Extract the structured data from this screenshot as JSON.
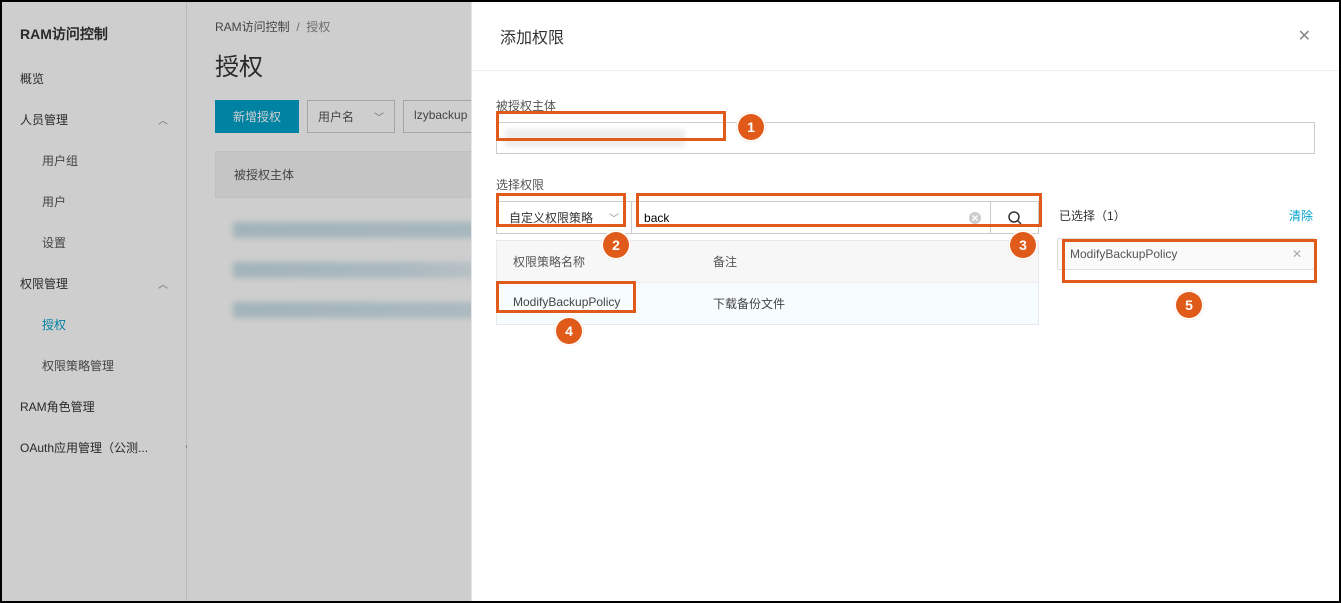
{
  "sidebar": {
    "title": "RAM访问控制",
    "items": [
      {
        "label": "概览"
      },
      {
        "label": "人员管理",
        "expandable": true
      },
      {
        "label": "用户组",
        "sub": true
      },
      {
        "label": "用户",
        "sub": true
      },
      {
        "label": "设置",
        "sub": true
      },
      {
        "label": "权限管理",
        "expandable": true
      },
      {
        "label": "授权",
        "sub": true,
        "active": true
      },
      {
        "label": "权限策略管理",
        "sub": true
      },
      {
        "label": "RAM角色管理"
      },
      {
        "label": "OAuth应用管理（公测..."
      }
    ]
  },
  "breadcrumbs": {
    "root": "RAM访问控制",
    "current": "授权"
  },
  "page_title": "授权",
  "toolbar": {
    "new_btn": "新增授权",
    "filter_type": "用户名",
    "filter_value": "lzybackup"
  },
  "table": {
    "col1": "被授权主体"
  },
  "panel": {
    "title": "添加权限",
    "subject_label": "被授权主体",
    "perm_label": "选择权限",
    "policy_type": "自定义权限策略",
    "search_value": "back",
    "table": {
      "col_name": "权限策略名称",
      "col_note": "备注",
      "rows": [
        {
          "name": "ModifyBackupPolicy",
          "note": "下载备份文件"
        }
      ]
    },
    "selected_label_prefix": "已选择（",
    "selected_count": "1",
    "selected_label_suffix": "）",
    "clear_label": "清除",
    "selected_items": [
      {
        "name": "ModifyBackupPolicy"
      }
    ]
  },
  "annotations": [
    "1",
    "2",
    "3",
    "4",
    "5"
  ]
}
